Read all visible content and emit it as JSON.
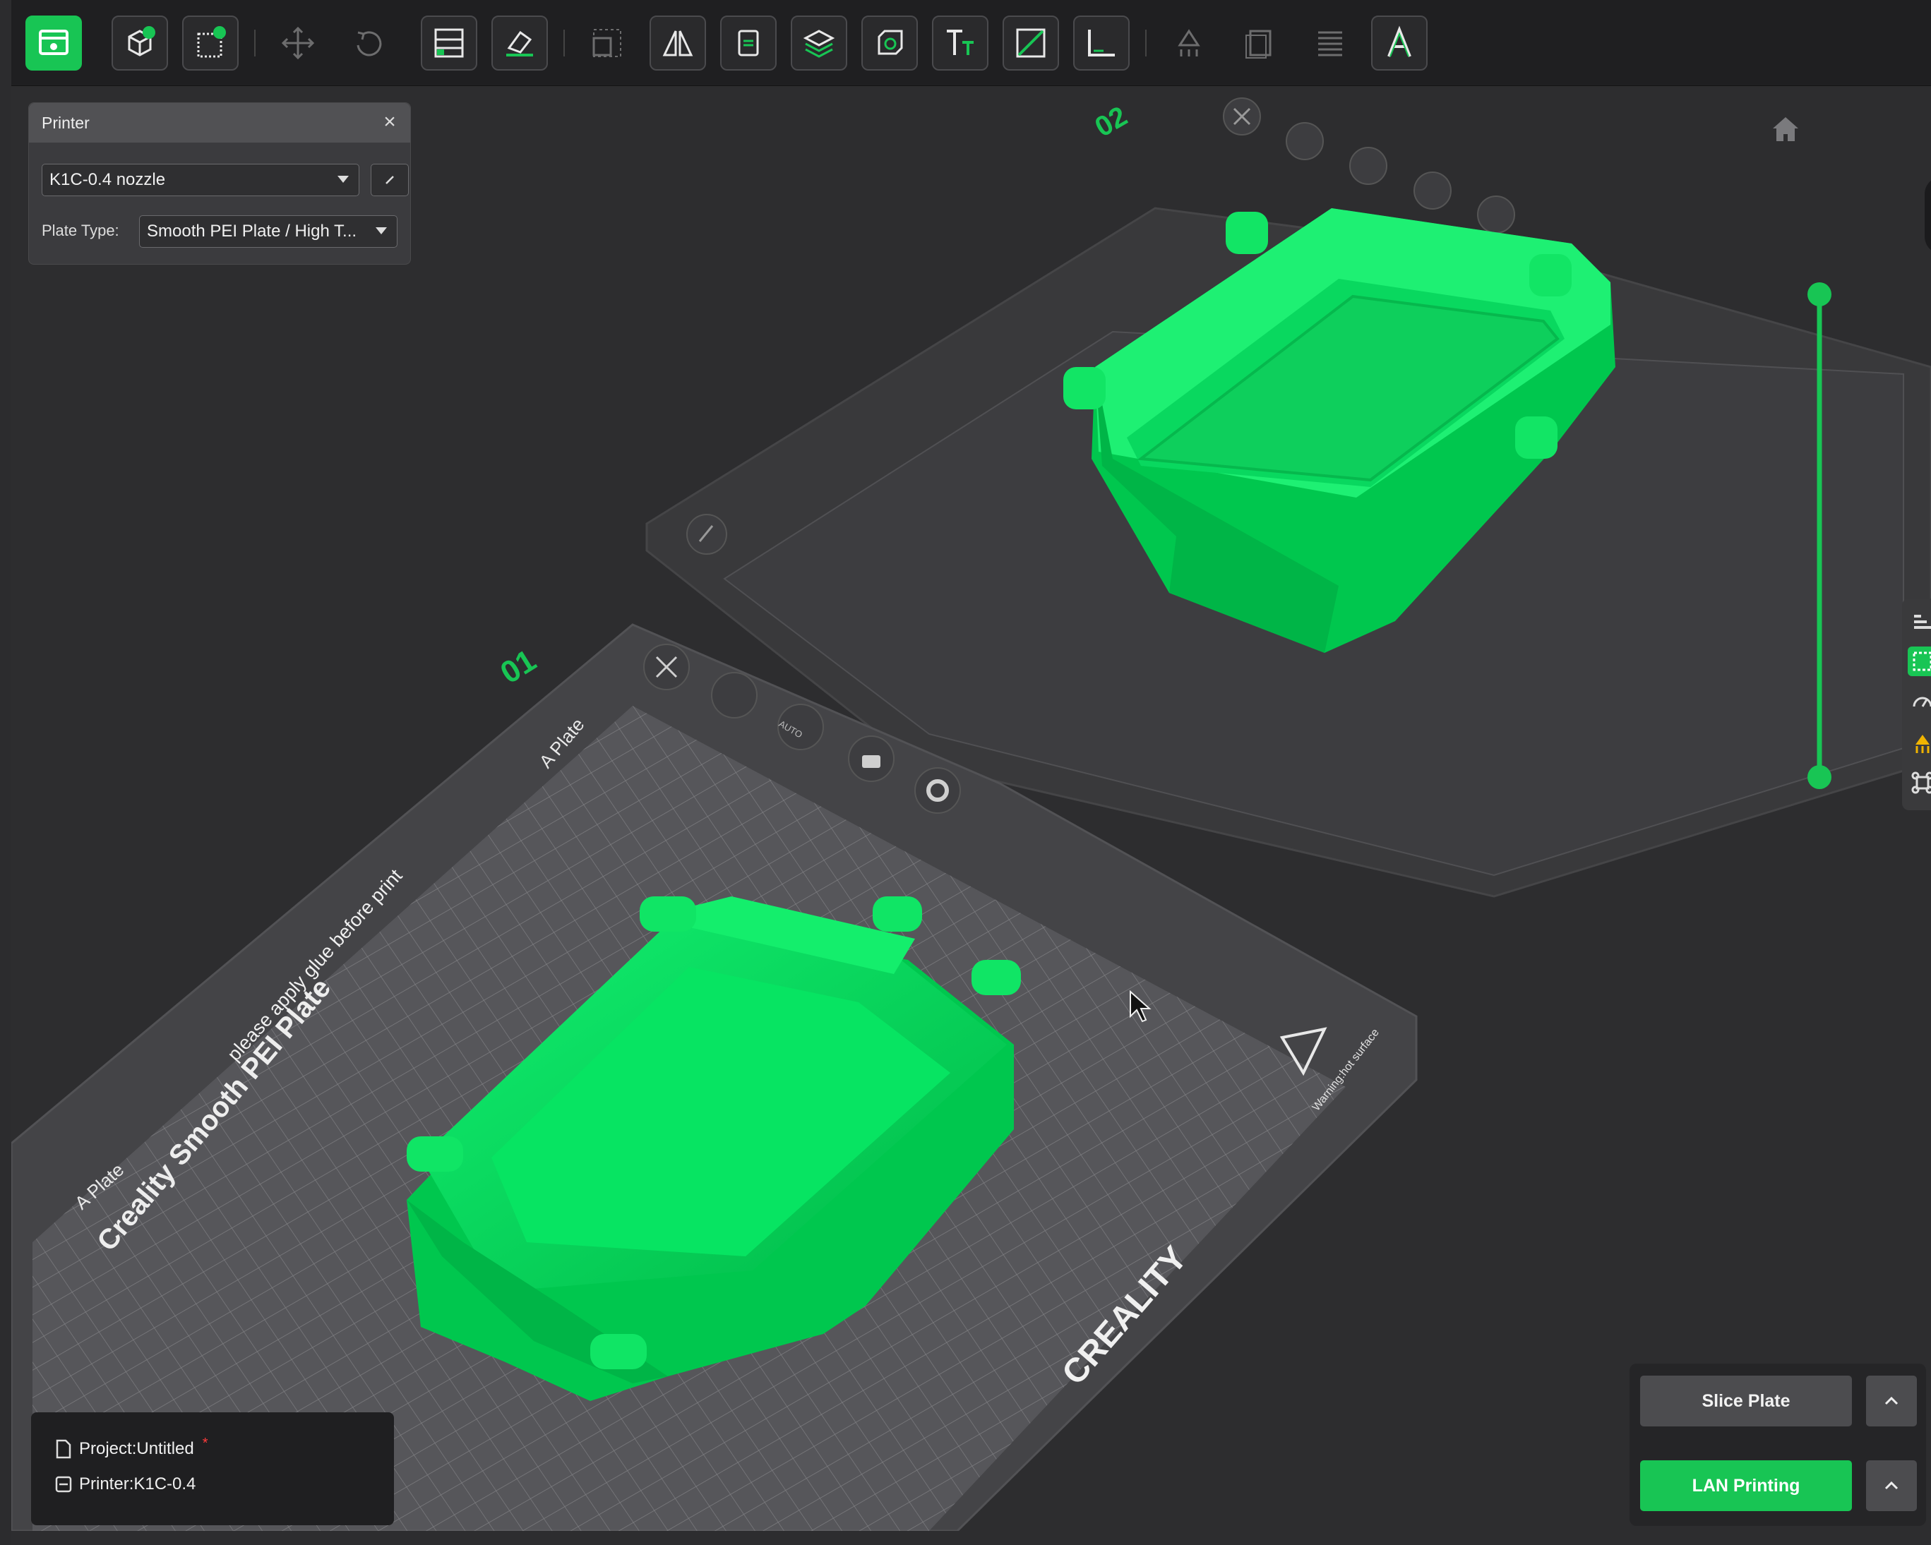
{
  "toolbar": {
    "tools": [
      {
        "name": "workspace-icon",
        "active": true
      },
      {
        "name": "add-model-icon"
      },
      {
        "name": "add-plate-icon"
      },
      {
        "name": "move-icon",
        "dim": true
      },
      {
        "name": "rotate-icon",
        "dim": true
      },
      {
        "name": "arrange-icon"
      },
      {
        "name": "lay-on-face-icon"
      },
      {
        "name": "scale-icon",
        "dim": true
      },
      {
        "name": "mirror-icon"
      },
      {
        "name": "copy-icon"
      },
      {
        "name": "slice-layers-icon"
      },
      {
        "name": "cut-icon"
      },
      {
        "name": "text-icon"
      },
      {
        "name": "split-icon"
      },
      {
        "name": "measure-icon"
      },
      {
        "name": "support-paint-icon",
        "dim": true
      },
      {
        "name": "seam-paint-icon",
        "dim": true
      },
      {
        "name": "variable-layer-icon",
        "dim": true
      },
      {
        "name": "emboss-icon"
      }
    ]
  },
  "printer_panel": {
    "title": "Printer",
    "printer": "K1C-0.4 nozzle",
    "plate_type_label": "Plate Type:",
    "plate_type": "Smooth PEI Plate / High T..."
  },
  "plates": {
    "plate1_number": "01",
    "plate2_number": "02",
    "plate_tab_text": "A Plate",
    "auto_label": "AUTO",
    "bed_name": "Creality Smooth PEI Plate",
    "bed_note": "please apply glue before print",
    "brand": "CREALITY",
    "warning": "Warning:hot surface"
  },
  "info": {
    "project": "Project:Untitled",
    "printer": "Printer:K1C-0.4"
  },
  "actions": {
    "slice": "Slice Plate",
    "lan": "LAN Printing"
  },
  "colors": {
    "accent": "#18c554",
    "model": "#00e05a",
    "background": "#2d2d2f"
  }
}
